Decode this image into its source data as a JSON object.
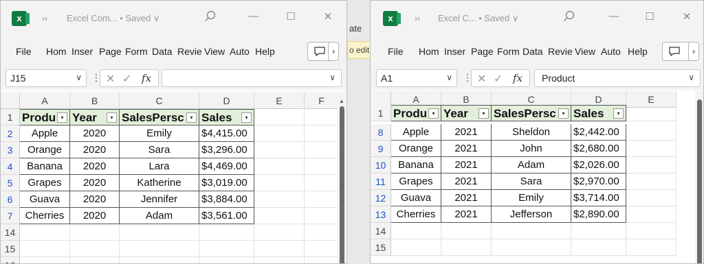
{
  "background_window": {
    "peek_text": "ate",
    "peek_banner": "o edit"
  },
  "left_window": {
    "title": "Excel Com... • Saved ∨",
    "menu": [
      "File",
      "Hom",
      "Inser",
      "Page",
      "Form",
      "Data",
      "Revie",
      "View",
      "Auto",
      "Help"
    ],
    "name_box": "J15",
    "formula": "",
    "columns": [
      "A",
      "B",
      "C",
      "D",
      "E",
      "F"
    ],
    "header_row_number": "1",
    "headers": [
      "Produ",
      "Year",
      "SalesPersc",
      "Sales"
    ],
    "rows": [
      {
        "num": "2",
        "product": "Apple",
        "year": "2020",
        "person": "Emily",
        "sales": "$4,415.00"
      },
      {
        "num": "3",
        "product": "Orange",
        "year": "2020",
        "person": "Sara",
        "sales": "$3,296.00"
      },
      {
        "num": "4",
        "product": "Banana",
        "year": "2020",
        "person": "Lara",
        "sales": "$4,469.00"
      },
      {
        "num": "5",
        "product": "Grapes",
        "year": "2020",
        "person": "Katherine",
        "sales": "$3,019.00"
      },
      {
        "num": "6",
        "product": "Guava",
        "year": "2020",
        "person": "Jennifer",
        "sales": "$3,884.00"
      },
      {
        "num": "7",
        "product": "Cherries",
        "year": "2020",
        "person": "Adam",
        "sales": "$3,561.00"
      }
    ],
    "empty_rows": [
      "14",
      "15",
      "16"
    ]
  },
  "right_window": {
    "title": "Excel C... • Saved ∨",
    "menu": [
      "File",
      "Hom",
      "Inser",
      "Page",
      "Form",
      "Data",
      "Revie",
      "View",
      "Auto",
      "Help"
    ],
    "name_box": "A1",
    "formula": "Product",
    "columns": [
      "A",
      "B",
      "C",
      "D",
      "E"
    ],
    "header_row_number": "1",
    "headers": [
      "Produ",
      "Year",
      "SalesPersc",
      "Sales"
    ],
    "rows": [
      {
        "num": "8",
        "product": "Apple",
        "year": "2021",
        "person": "Sheldon",
        "sales": "$2,442.00"
      },
      {
        "num": "9",
        "product": "Orange",
        "year": "2021",
        "person": "John",
        "sales": "$2,680.00"
      },
      {
        "num": "10",
        "product": "Banana",
        "year": "2021",
        "person": "Adam",
        "sales": "$2,026.00"
      },
      {
        "num": "11",
        "product": "Grapes",
        "year": "2021",
        "person": "Sara",
        "sales": "$2,970.00"
      },
      {
        "num": "12",
        "product": "Guava",
        "year": "2021",
        "person": "Emily",
        "sales": "$3,714.00"
      },
      {
        "num": "13",
        "product": "Cherries",
        "year": "2021",
        "person": "Jefferson",
        "sales": "$2,890.00"
      }
    ],
    "empty_rows": [
      "14",
      "15"
    ]
  },
  "colors": {
    "excel_green": "#107c41",
    "header_fill": "#e2efda",
    "filtered_row_number": "#1e50c8"
  },
  "icons": [
    "excel-logo-icon",
    "search-icon",
    "minimize-icon",
    "maximize-icon",
    "close-icon",
    "comment-icon",
    "cancel-icon",
    "enter-icon",
    "function-icon",
    "filter-dropdown-icon",
    "filter-active-icon"
  ]
}
